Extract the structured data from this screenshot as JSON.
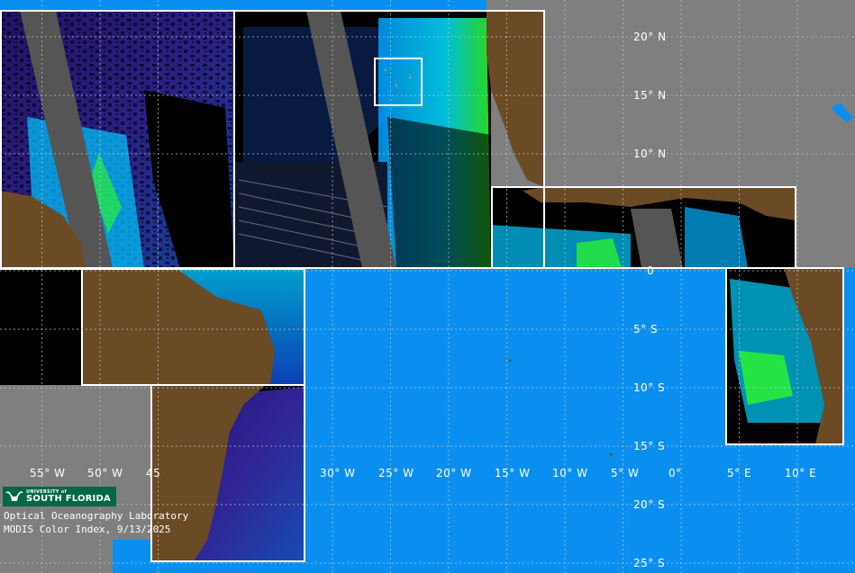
{
  "map": {
    "latitude_labels": [
      {
        "value": 20,
        "text": "20° N"
      },
      {
        "value": 15,
        "text": "15° N"
      },
      {
        "value": 10,
        "text": "10° N"
      },
      {
        "value": 0,
        "text": "0"
      },
      {
        "value": -5,
        "text": "5° S"
      },
      {
        "value": -10,
        "text": "10° S"
      },
      {
        "value": -15,
        "text": "15° S"
      },
      {
        "value": -20,
        "text": "20° S"
      },
      {
        "value": -25,
        "text": "25° S"
      }
    ],
    "longitude_labels": [
      {
        "value": -55,
        "text": "55° W"
      },
      {
        "value": -50,
        "text": "50° W"
      },
      {
        "value": -45,
        "text": "45"
      },
      {
        "value": -30,
        "text": "30° W"
      },
      {
        "value": -25,
        "text": "25° W"
      },
      {
        "value": -20,
        "text": "20° W"
      },
      {
        "value": -15,
        "text": "15° W"
      },
      {
        "value": -10,
        "text": "10° W"
      },
      {
        "value": -5,
        "text": "5° W"
      },
      {
        "value": 0,
        "text": "0°"
      },
      {
        "value": 5,
        "text": "5° E"
      },
      {
        "value": 10,
        "text": "10° E"
      }
    ],
    "colors": {
      "land": "#6b4a26",
      "ocean": "#0a8ff0",
      "nodata": "#7f7f7f",
      "cloud": "#000000",
      "orbit_gap": "#555555",
      "box_outline": "#ffffff",
      "grid": "#c8c8c8",
      "color_index_low": "#3a1a9a",
      "color_index_mid": "#00b4ff",
      "color_index_high": "#30ff20"
    }
  },
  "branding": {
    "university_small": "UNIVERSITY of",
    "university_name": "SOUTH FLORIDA",
    "lab_name": "Optical Oceanography Laboratory",
    "caption": "MODIS Color Index, 9/13/2025",
    "logo_icon": "bull-horns-icon",
    "logo_color": "#006747"
  }
}
